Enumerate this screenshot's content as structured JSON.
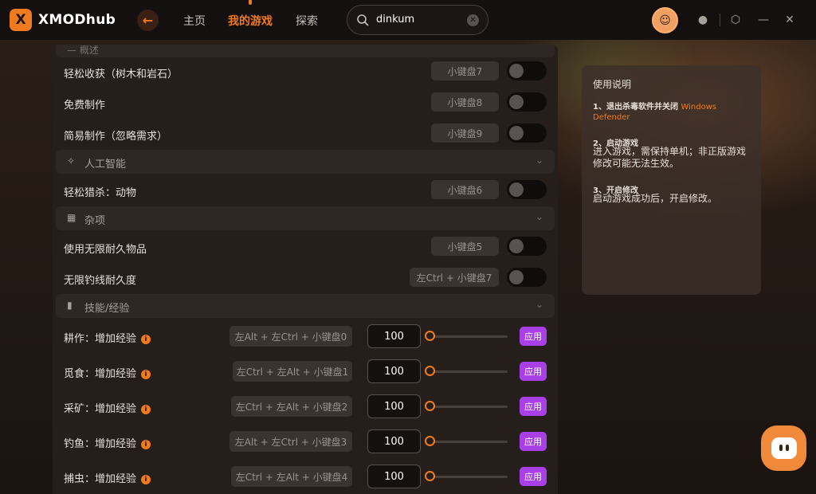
{
  "header": {
    "logo_mark": "X",
    "logo_text": "XMODhub",
    "nav": [
      "主页",
      "我的游戏",
      "探索"
    ],
    "search_value": "dinkum"
  },
  "top_section_partial": "— 概述",
  "rows_a": [
    {
      "label": "轻松收获（树木和岩石）",
      "key": "小键盘7"
    },
    {
      "label": "免费制作",
      "key": "小键盘8"
    },
    {
      "label": "简易制作（忽略需求）",
      "key": "小键盘9"
    }
  ],
  "section_ai": {
    "title": "人工智能"
  },
  "rows_b": [
    {
      "label": "轻松猎杀：动物",
      "key": "小键盘6"
    }
  ],
  "section_misc": {
    "title": "杂项"
  },
  "rows_c": [
    {
      "label": "使用无限耐久物品",
      "key": "小键盘5"
    },
    {
      "label": "无限钓线耐久度",
      "key": "左Ctrl + 小键盘7"
    }
  ],
  "section_skill": {
    "title": "技能/经验"
  },
  "xp_rows": [
    {
      "label": "耕作：增加经验",
      "key": "左Alt + 左Ctrl + 小键盘0",
      "value": "100",
      "apply": "应用"
    },
    {
      "label": "觅食：增加经验",
      "key": "左Ctrl + 左Alt + 小键盘1",
      "value": "100",
      "apply": "应用"
    },
    {
      "label": "采矿：增加经验",
      "key": "左Ctrl + 左Alt + 小键盘2",
      "value": "100",
      "apply": "应用"
    },
    {
      "label": "钓鱼：增加经验",
      "key": "左Alt + 左Ctrl + 小键盘3",
      "value": "100",
      "apply": "应用"
    },
    {
      "label": "捕虫：增加经验",
      "key": "左Ctrl + 左Alt + 小键盘4",
      "value": "100",
      "apply": "应用"
    }
  ],
  "guide": {
    "title": "使用说明",
    "step1_title": "1、退出杀毒软件并关闭",
    "step1_link": "Windows Defender",
    "step2_title": "2、启动游戏",
    "step2_body": "进入游戏，需保持单机；非正版游戏修改可能无法生效。",
    "step3_title": "3、开启修改",
    "step3_body": "启动游戏成功后，开启修改。"
  },
  "colors": {
    "accent": "#f07b1f",
    "apply": "#a93fe6",
    "panel": "#251e1a"
  }
}
